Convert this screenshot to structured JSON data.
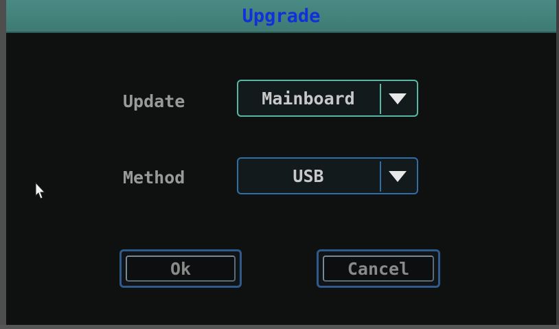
{
  "dialog": {
    "title": "Upgrade"
  },
  "form": {
    "update_label": "Update",
    "update_value": "Mainboard",
    "method_label": "Method",
    "method_value": "USB"
  },
  "buttons": {
    "ok_label": "Ok",
    "cancel_label": "Cancel"
  },
  "colors": {
    "title_bar": "#4a8a84",
    "title_text": "#1230d8",
    "background": "#0f1111",
    "update_border": "#58b8a8",
    "method_border": "#2f6fa8"
  },
  "icons": {
    "dropdown": "triangle-down-icon",
    "pointer": "mouse-pointer-icon"
  }
}
